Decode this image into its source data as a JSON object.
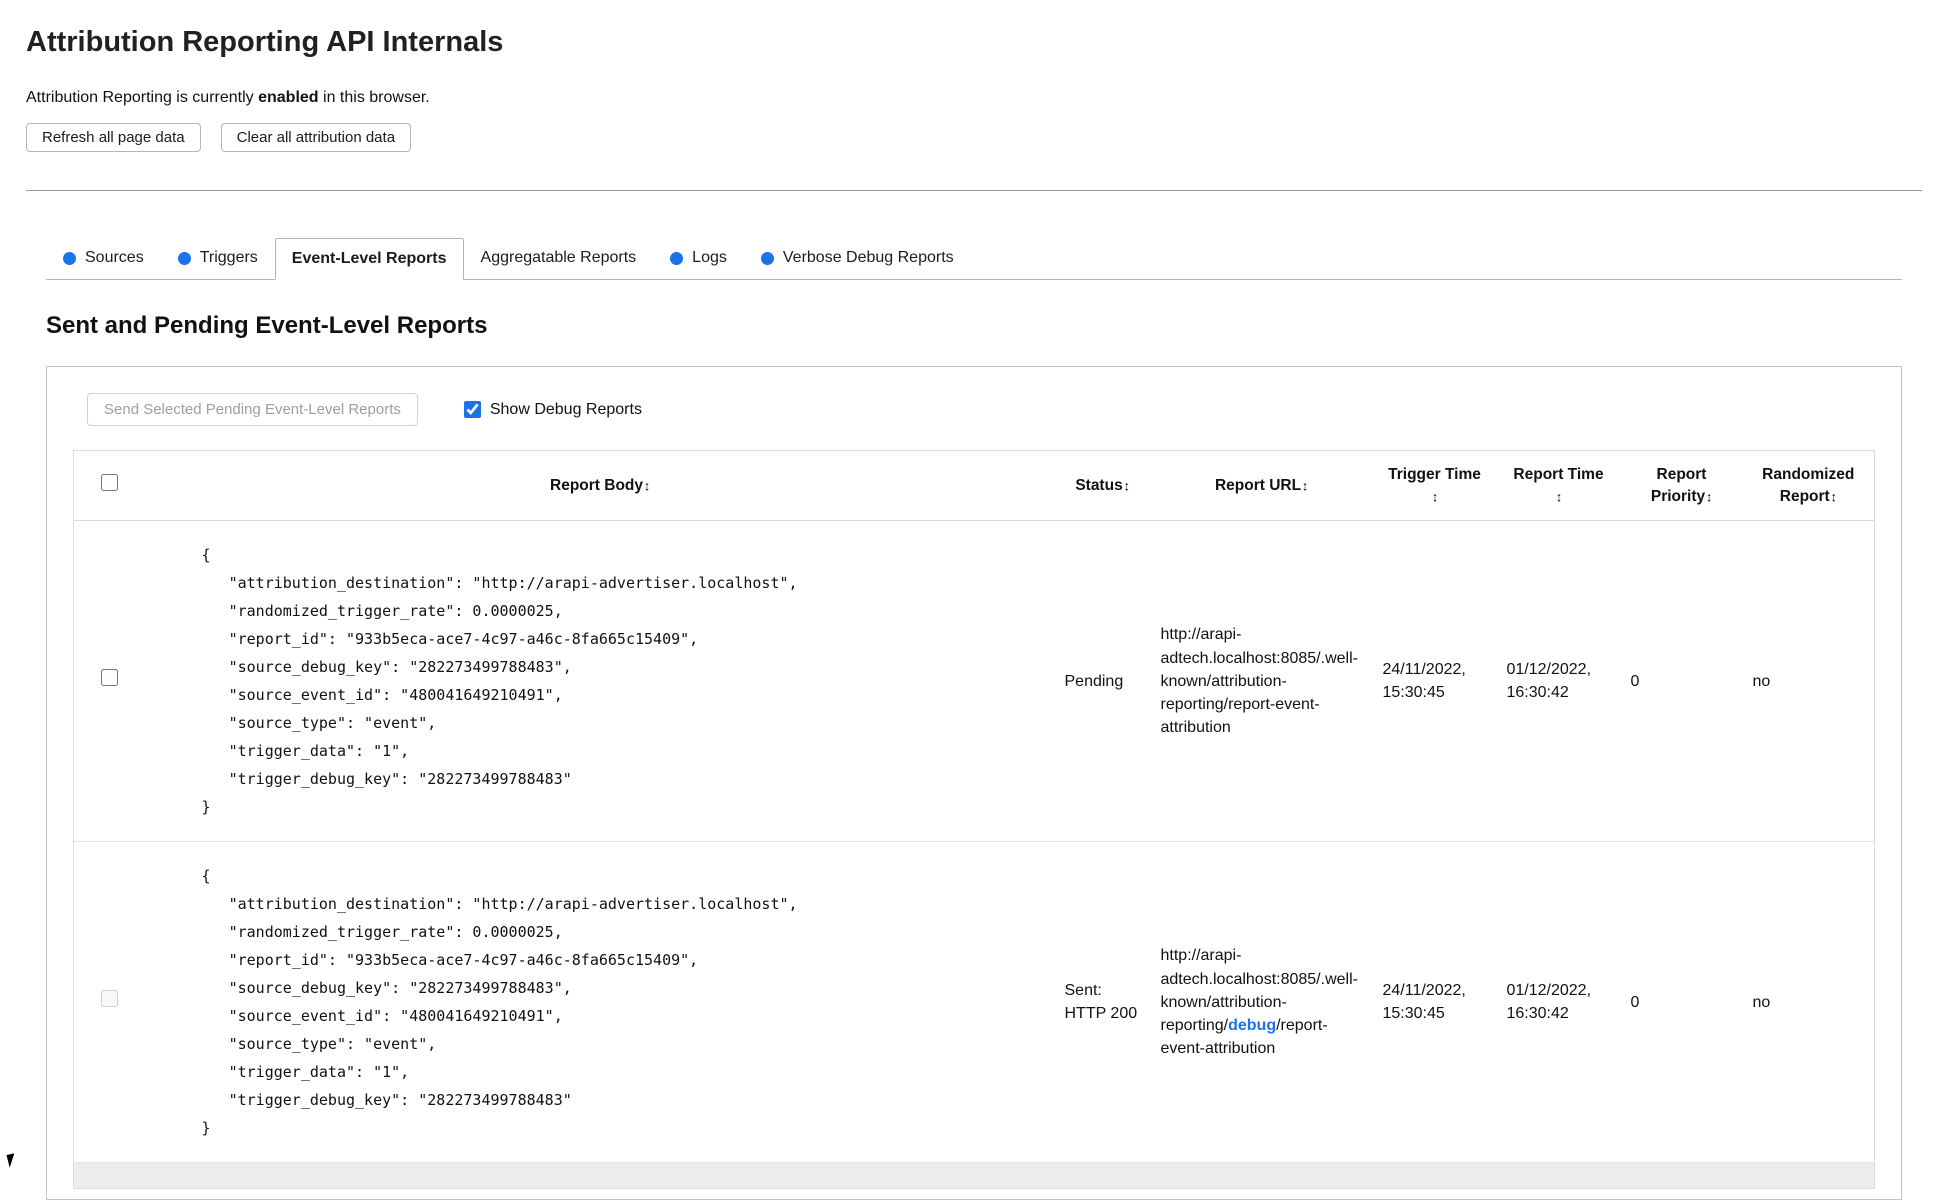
{
  "colors": {
    "accent_blue": "#1a73e8",
    "dot_blue": "#1a73e8",
    "debug_link_blue": "#1a73e8",
    "border_gray": "#c4c4c4",
    "disabled_text_gray": "#9e9e9e",
    "footer_bar_gray": "#ededed"
  },
  "header": {
    "title": "Attribution Reporting API Internals",
    "status_prefix": "Attribution Reporting is currently ",
    "status_bold": "enabled",
    "status_suffix": " in this browser.",
    "refresh_button": "Refresh all page data",
    "clear_button": "Clear all attribution data"
  },
  "tabs": [
    {
      "label": "Sources",
      "has_dot": true,
      "active": false
    },
    {
      "label": "Triggers",
      "has_dot": true,
      "active": false
    },
    {
      "label": "Event-Level Reports",
      "has_dot": false,
      "active": true
    },
    {
      "label": "Aggregatable Reports",
      "has_dot": false,
      "active": false
    },
    {
      "label": "Logs",
      "has_dot": true,
      "active": false
    },
    {
      "label": "Verbose Debug Reports",
      "has_dot": true,
      "active": false
    }
  ],
  "section": {
    "heading": "Sent and Pending Event-Level Reports",
    "send_button": "Send Selected Pending Event-Level Reports",
    "show_debug_label": "Show Debug Reports",
    "show_debug_checked": true
  },
  "table": {
    "sort_icon": "↕",
    "headers": {
      "report_body": "Report Body",
      "status": "Status",
      "report_url": "Report URL",
      "trigger_time": "Trigger Time",
      "report_time": "Report Time",
      "report_priority": "Report Priority",
      "randomized_report": "Randomized Report"
    },
    "rows": [
      {
        "body": "{\n   \"attribution_destination\": \"http://arapi-advertiser.localhost\",\n   \"randomized_trigger_rate\": 0.0000025,\n   \"report_id\": \"933b5eca-ace7-4c97-a46c-8fa665c15409\",\n   \"source_debug_key\": \"282273499788483\",\n   \"source_event_id\": \"480041649210491\",\n   \"source_type\": \"event\",\n   \"trigger_data\": \"1\",\n   \"trigger_debug_key\": \"282273499788483\"\n}",
        "status": "Pending",
        "url_pre": "http://arapi-adtech.localhost:8085/.well-known/attribution-reporting/report-event-attribution",
        "url_link": "",
        "url_post": "",
        "trigger_time": "24/11/2022, 15:30:45",
        "report_time": "01/12/2022, 16:30:42",
        "priority": "0",
        "randomized": "no",
        "checkbox_enabled": true
      },
      {
        "body": "{\n   \"attribution_destination\": \"http://arapi-advertiser.localhost\",\n   \"randomized_trigger_rate\": 0.0000025,\n   \"report_id\": \"933b5eca-ace7-4c97-a46c-8fa665c15409\",\n   \"source_debug_key\": \"282273499788483\",\n   \"source_event_id\": \"480041649210491\",\n   \"source_type\": \"event\",\n   \"trigger_data\": \"1\",\n   \"trigger_debug_key\": \"282273499788483\"\n}",
        "status": "Sent: HTTP 200",
        "url_pre": "http://arapi-adtech.localhost:8085/.well-known/attribution-reporting/",
        "url_link": "debug",
        "url_post": "/report-event-attribution",
        "trigger_time": "24/11/2022, 15:30:45",
        "report_time": "01/12/2022, 16:30:42",
        "priority": "0",
        "randomized": "no",
        "checkbox_enabled": false
      }
    ]
  }
}
